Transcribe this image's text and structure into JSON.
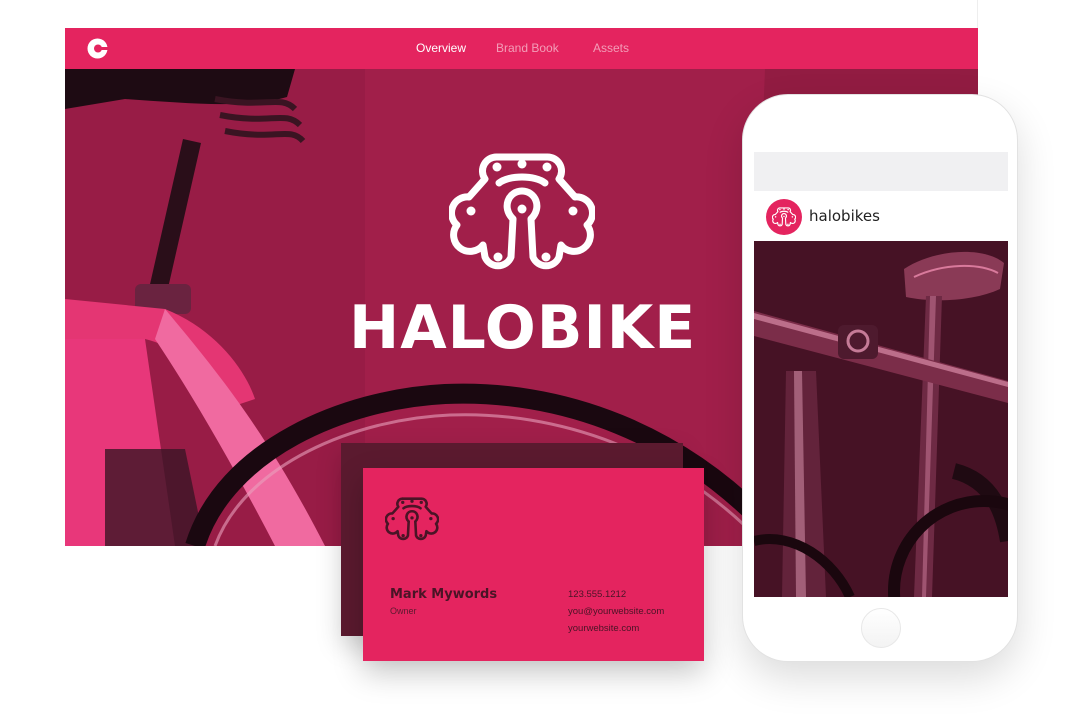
{
  "colors": {
    "brand_pink": "#e4245f",
    "hero_overlay": "#9e1d47",
    "card_back": "#5b1a2f",
    "ink_dark": "#4a1426",
    "white": "#ffffff"
  },
  "site": {
    "logo_icon": "e-logo-icon",
    "nav": [
      {
        "label": "Overview",
        "active": true
      },
      {
        "label": "Brand Book",
        "active": false
      },
      {
        "label": "Assets",
        "active": false
      }
    ],
    "hero": {
      "mark_icon": "bike-chain-logo-icon",
      "wordmark": "HALOBIKE"
    }
  },
  "business_card": {
    "mark_icon": "bike-chain-logo-icon",
    "name": "Mark Mywords",
    "title": "Owner",
    "phone": "123.555.1212",
    "email": "you@yourwebsite.com",
    "website": "yourwebsite.com"
  },
  "phone": {
    "avatar_icon": "bike-chain-logo-icon",
    "username": "halobikes"
  }
}
